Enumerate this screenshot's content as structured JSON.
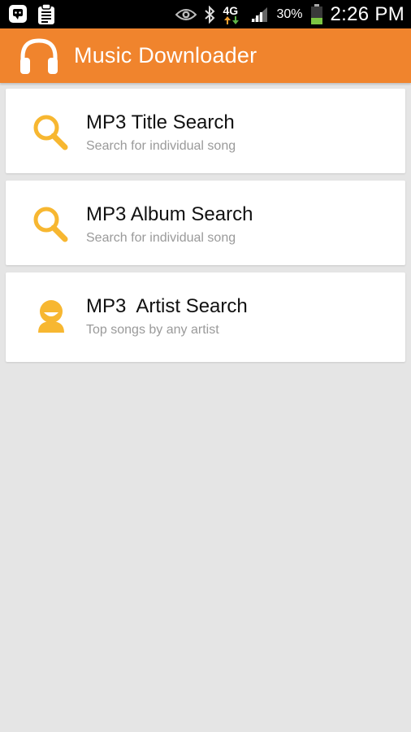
{
  "status_bar": {
    "network": "4G",
    "battery_percent": "30%",
    "time": "2:26 PM",
    "icons": [
      "chat-icon",
      "clipboard-icon",
      "eye-icon",
      "bluetooth-icon",
      "network-4g-icon",
      "signal-icon",
      "battery-icon"
    ]
  },
  "app_bar": {
    "title": "Music Downloader",
    "logo": "headphones-icon",
    "color": "#f0842d"
  },
  "menu": {
    "items": [
      {
        "title": "MP3 Title Search",
        "subtitle": "Search for individual song",
        "icon": "search-icon"
      },
      {
        "title": "MP3 Album Search",
        "subtitle": "Search for individual song",
        "icon": "search-icon"
      },
      {
        "title": "MP3  Artist Search",
        "subtitle": "Top songs by any artist",
        "icon": "person-icon"
      }
    ],
    "icon_color": "#f7b731"
  }
}
